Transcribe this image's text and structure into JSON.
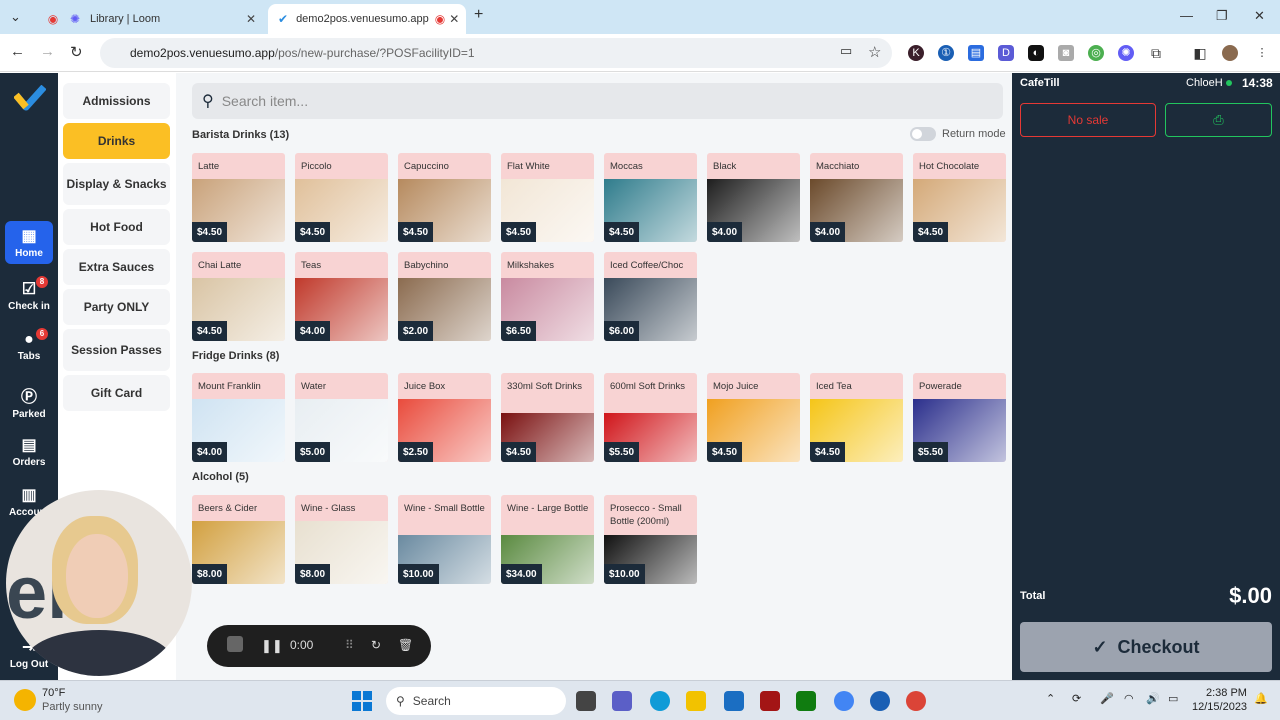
{
  "browser": {
    "tabs": [
      {
        "title": "Library | Loom",
        "active": false
      },
      {
        "title": "demo2pos.venuesumo.app",
        "active": true
      }
    ],
    "url_host": "demo2pos.venuesumo.app",
    "url_path": "/pos/new-purchase/?POSFacilityID=1"
  },
  "nav": [
    {
      "label": "Home",
      "icon": "grid-icon",
      "badge": ""
    },
    {
      "label": "Check in",
      "icon": "calendar-check-icon",
      "badge": "8"
    },
    {
      "label": "Tabs",
      "icon": "user-icon",
      "badge": "6"
    },
    {
      "label": "Parked",
      "icon": "parking-icon",
      "badge": ""
    },
    {
      "label": "Orders",
      "icon": "receipt-icon",
      "badge": ""
    },
    {
      "label": "Account",
      "icon": "register-icon",
      "badge": ""
    },
    {
      "label": "Log Out",
      "icon": "logout-icon",
      "badge": ""
    }
  ],
  "categories": [
    "Admissions",
    "Drinks",
    "Display & Snacks",
    "Hot Food",
    "Extra Sauces",
    "Party ONLY",
    "Session Passes",
    "Gift Card"
  ],
  "search_placeholder": "Search item...",
  "return_mode_label": "Return mode",
  "sections": [
    {
      "title": "Barista Drinks (13)",
      "items": [
        {
          "name": "Latte",
          "price": "$4.50"
        },
        {
          "name": "Piccolo",
          "price": "$4.50"
        },
        {
          "name": "Capuccino",
          "price": "$4.50"
        },
        {
          "name": "Flat White",
          "price": "$4.50"
        },
        {
          "name": "Moccas",
          "price": "$4.50"
        },
        {
          "name": "Black",
          "price": "$4.00"
        },
        {
          "name": "Macchiato",
          "price": "$4.00"
        },
        {
          "name": "Hot Chocolate",
          "price": "$4.50"
        },
        {
          "name": "Chai Latte",
          "price": "$4.50"
        },
        {
          "name": "Teas",
          "price": "$4.00"
        },
        {
          "name": "Babychino",
          "price": "$2.00"
        },
        {
          "name": "Milkshakes",
          "price": "$6.50"
        },
        {
          "name": "Iced Coffee/Choc",
          "price": "$6.00"
        }
      ]
    },
    {
      "title": "Fridge Drinks (8)",
      "items": [
        {
          "name": "Mount Franklin",
          "price": "$4.00"
        },
        {
          "name": "Water",
          "price": "$5.00"
        },
        {
          "name": "Juice Box",
          "price": "$2.50"
        },
        {
          "name": "330ml Soft Drinks",
          "price": "$4.50"
        },
        {
          "name": "600ml Soft Drinks",
          "price": "$5.50"
        },
        {
          "name": "Mojo Juice",
          "price": "$4.50"
        },
        {
          "name": "Iced Tea",
          "price": "$4.50"
        },
        {
          "name": "Powerade",
          "price": "$5.50"
        }
      ]
    },
    {
      "title": "Alcohol (5)",
      "items": [
        {
          "name": "Beers & Cider",
          "price": "$8.00"
        },
        {
          "name": "Wine - Glass",
          "price": "$8.00"
        },
        {
          "name": "Wine - Small Bottle",
          "price": "$10.00"
        },
        {
          "name": "Wine - Large Bottle",
          "price": "$34.00"
        },
        {
          "name": "Prosecco - Small Bottle (200ml)",
          "price": "$10.00"
        }
      ]
    }
  ],
  "register": {
    "till": "CafeTill",
    "user": "ChloeH",
    "time": "14:38",
    "no_sale": "No sale",
    "total_label": "Total",
    "total_value": "$.00",
    "checkout": "Checkout"
  },
  "recorder": {
    "time": "0:00"
  },
  "taskbar": {
    "weather_temp": "70°F",
    "weather_desc": "Partly sunny",
    "search": "Search",
    "clock_time": "2:38 PM",
    "clock_date": "12/15/2023"
  }
}
